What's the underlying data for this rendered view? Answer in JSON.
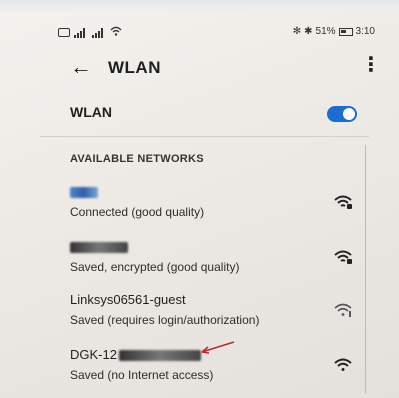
{
  "status_bar": {
    "battery_percent": "51%",
    "time": "3:10"
  },
  "header": {
    "title": "WLAN"
  },
  "wlan_toggle": {
    "label": "WLAN",
    "enabled": true,
    "accent_color": "#1c6dd0"
  },
  "section": {
    "available_networks": "AVAILABLE NETWORKS"
  },
  "networks": [
    {
      "name": "",
      "status": "Connected (good quality)",
      "icon": "wifi-icon"
    },
    {
      "name": "",
      "status": "Saved, encrypted (good quality)",
      "icon": "wifi-icon"
    },
    {
      "name": "Linksys06561-guest",
      "status": "Saved (requires login/authorization)",
      "icon": "wifi-icon"
    },
    {
      "name": "DGK-12",
      "status": "Saved (no Internet access)",
      "icon": "wifi-icon"
    }
  ]
}
